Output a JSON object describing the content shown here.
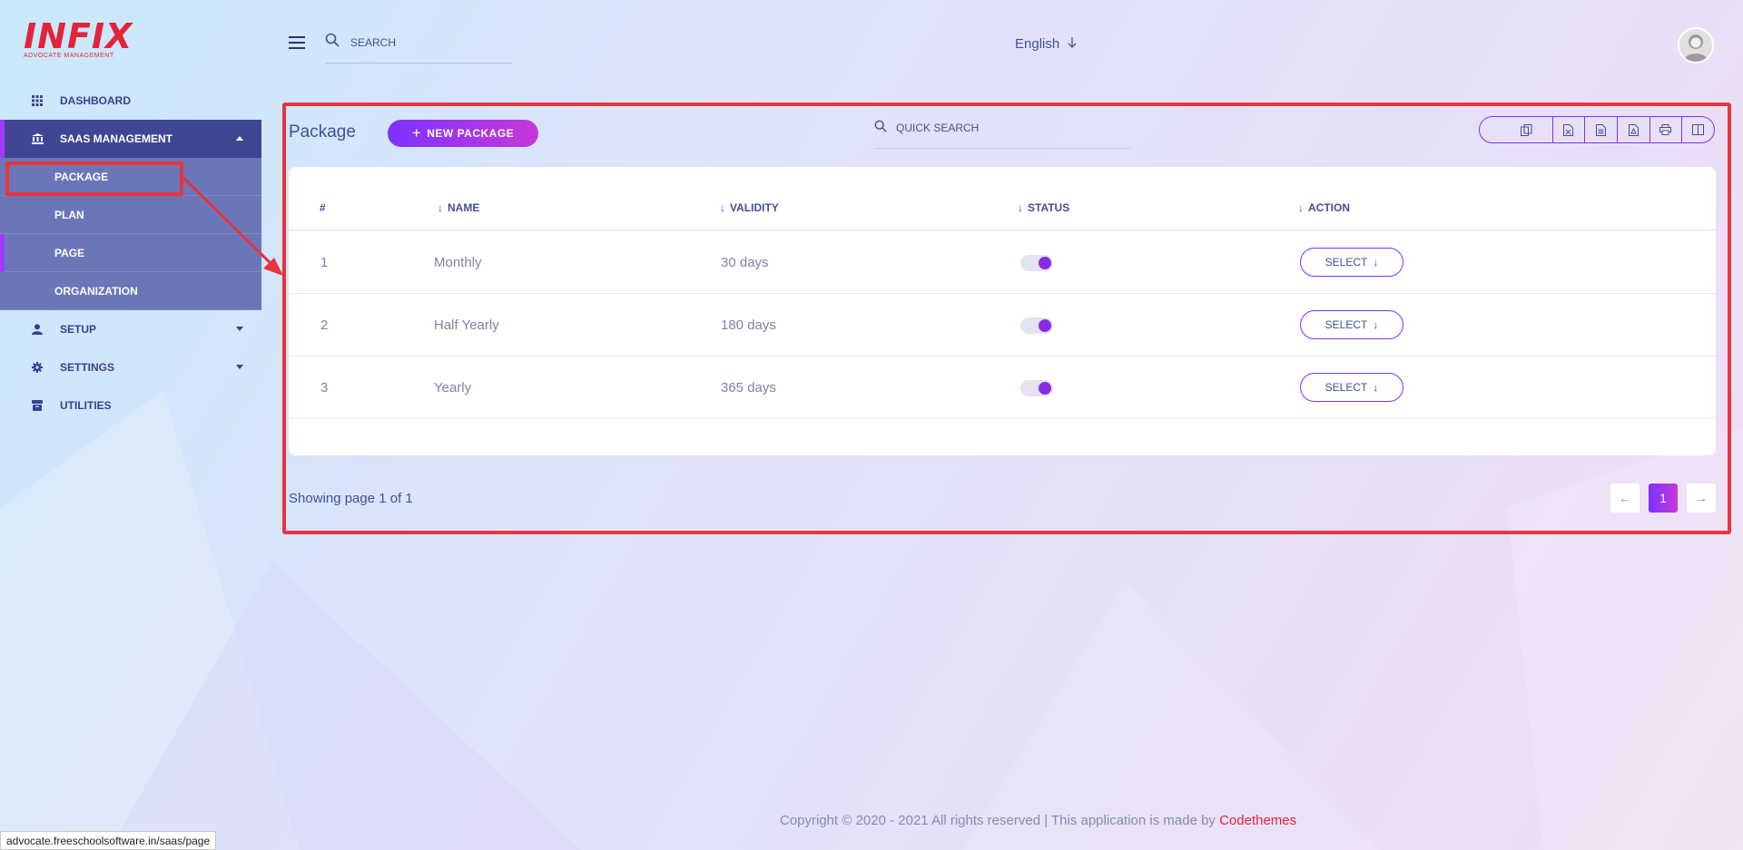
{
  "brand": {
    "name": "INFIX",
    "tagline": "ADVOCATE MANAGEMENT"
  },
  "sidebar": {
    "items": [
      {
        "label": "DASHBOARD",
        "icon": "grid-icon"
      },
      {
        "label": "SAAS MANAGEMENT",
        "icon": "bank-icon",
        "expanded": true,
        "children": [
          {
            "label": "PACKAGE"
          },
          {
            "label": "PLAN"
          },
          {
            "label": "PAGE"
          },
          {
            "label": "ORGANIZATION"
          }
        ]
      },
      {
        "label": "SETUP",
        "icon": "user-icon"
      },
      {
        "label": "SETTINGS",
        "icon": "gear-icon"
      },
      {
        "label": "UTILITIES",
        "icon": "archive-icon"
      }
    ]
  },
  "header": {
    "search_placeholder": "SEARCH",
    "language": "English"
  },
  "main": {
    "title": "Package",
    "new_button": "NEW PACKAGE",
    "quick_search_placeholder": "QUICK SEARCH",
    "export_buttons": [
      "copy-icon",
      "excel-icon",
      "csv-icon",
      "pdf-icon",
      "print-icon",
      "columns-icon"
    ],
    "table": {
      "columns": [
        "#",
        "NAME",
        "VALIDITY",
        "STATUS",
        "ACTION"
      ],
      "rows": [
        {
          "id": "1",
          "name": "Monthly",
          "validity": "30 days",
          "status": true,
          "action": "SELECT"
        },
        {
          "id": "2",
          "name": "Half Yearly",
          "validity": "180 days",
          "status": true,
          "action": "SELECT"
        },
        {
          "id": "3",
          "name": "Yearly",
          "validity": "365 days",
          "status": true,
          "action": "SELECT"
        }
      ]
    },
    "pagination": {
      "info": "Showing page 1 of 1",
      "current": "1",
      "prev": "←",
      "next": "→"
    }
  },
  "footer": {
    "text": "Copyright © 2020 - 2021 All rights reserved | This application is made by ",
    "brand": "Codethemes"
  },
  "statusbar": {
    "url": "advocate.freeschoolsoftware.in/saas/page"
  },
  "colors": {
    "accent": "#7c32ff",
    "highlight": "#e8343c",
    "nav_active": "#3f4693",
    "nav_sub": "#6a76b8",
    "brand_red": "#e2243b"
  }
}
